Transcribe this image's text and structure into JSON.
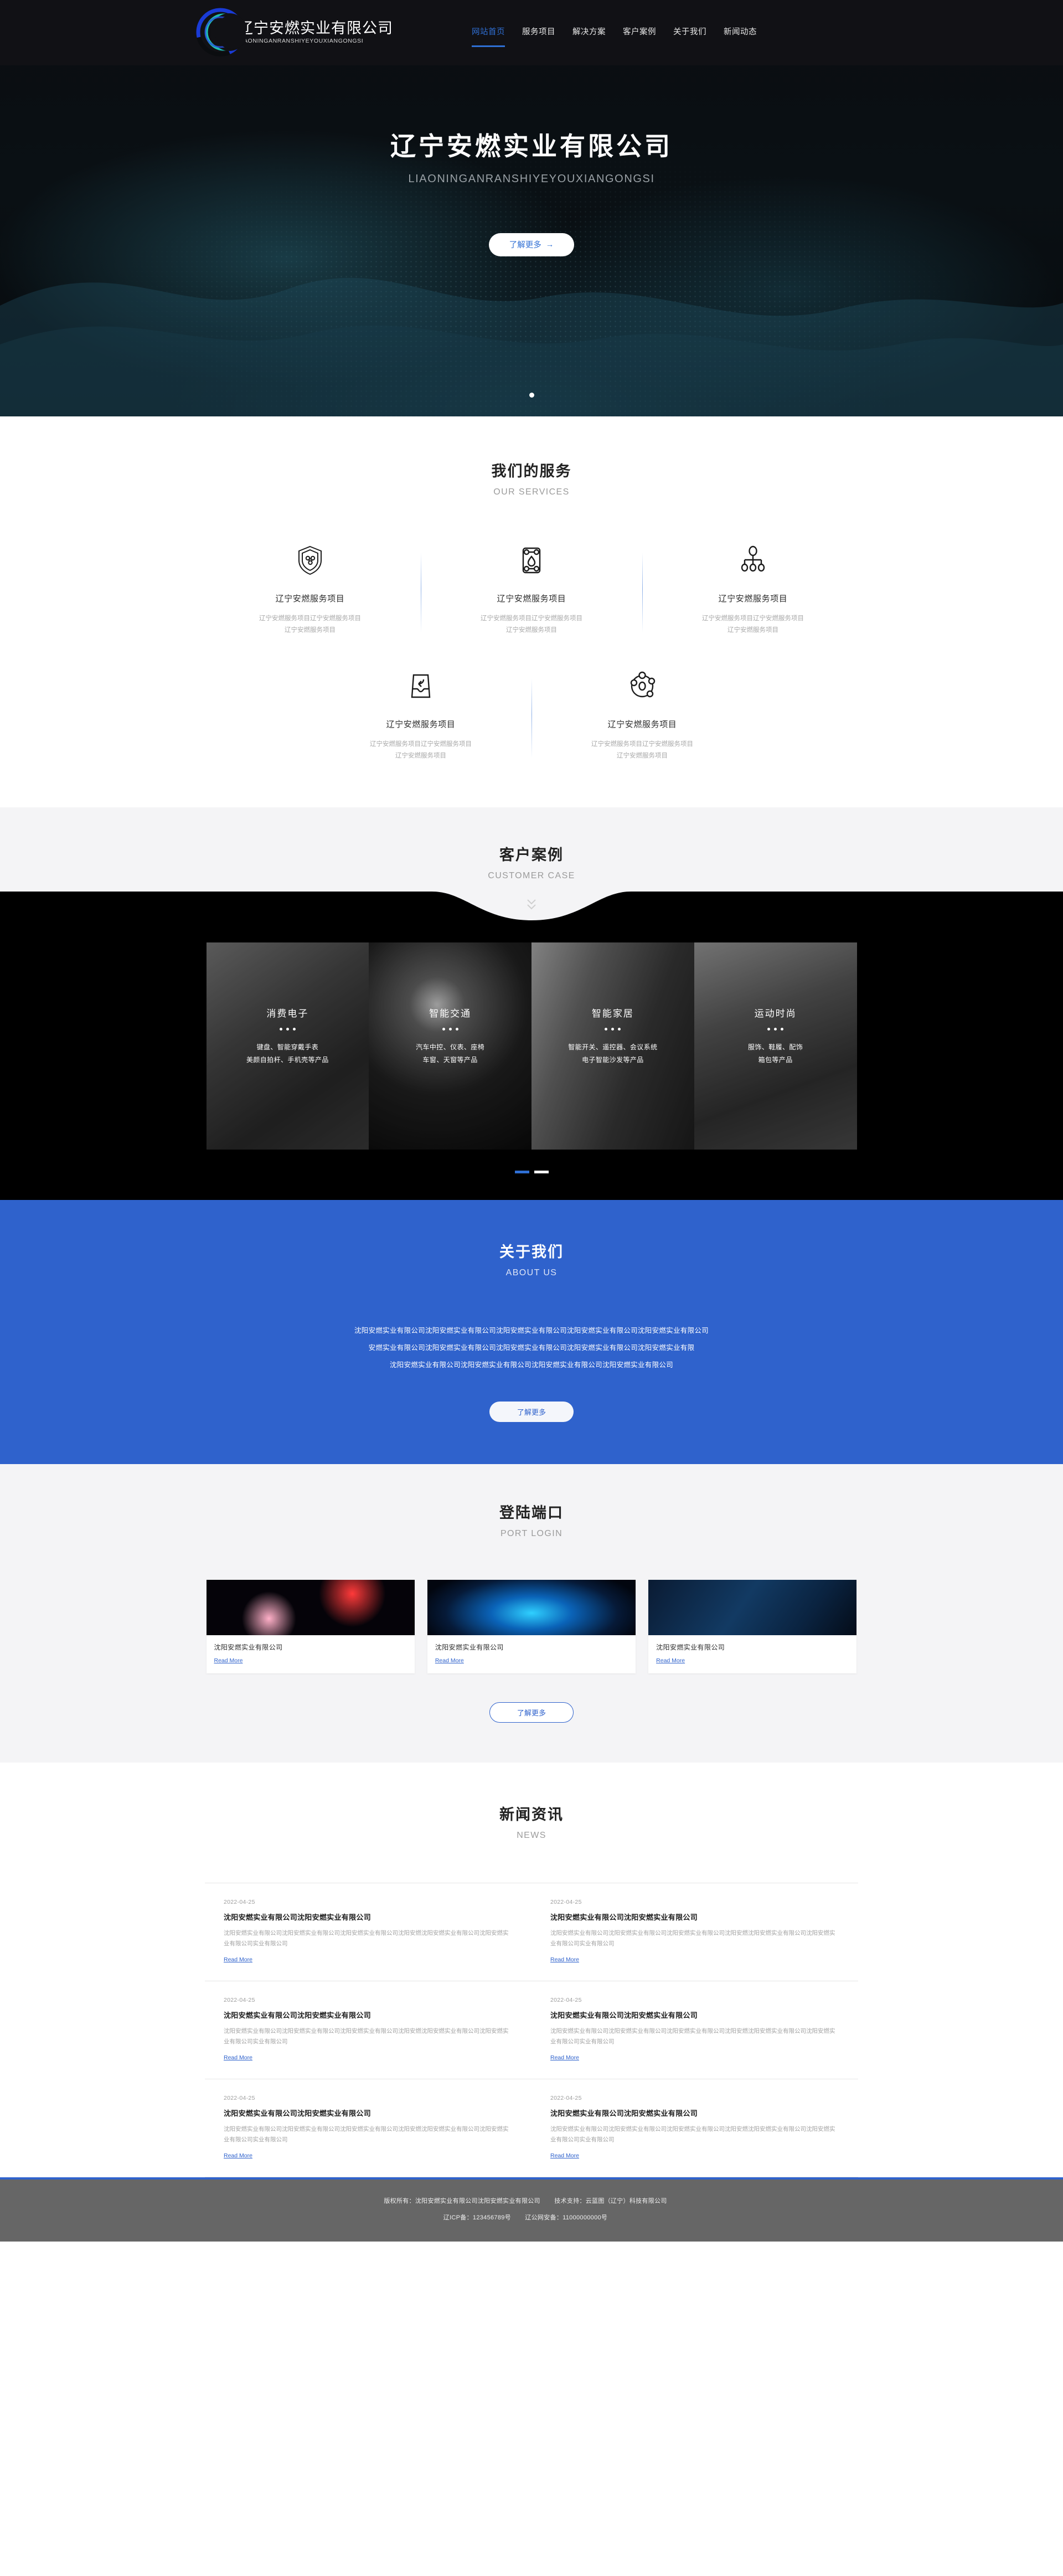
{
  "brand": {
    "name_cn": "辽宁安燃实业有限公司",
    "name_en": "LIAONINGANRANSHIYEYOUXIANGONGSI",
    "accent": "#2f62cc",
    "logo_icon": "crescent-ring-logo"
  },
  "nav": {
    "items": [
      {
        "label": "网站首页",
        "active": true
      },
      {
        "label": "服务项目",
        "active": false
      },
      {
        "label": "解决方案",
        "active": false
      },
      {
        "label": "客户案例",
        "active": false
      },
      {
        "label": "关于我们",
        "active": false
      },
      {
        "label": "新闻动态",
        "active": false
      }
    ]
  },
  "hero": {
    "title": "辽宁安燃实业有限公司",
    "subtitle": "LIAONINGANRANSHIYEYOUXIANGONGSI",
    "cta": "了解更多",
    "cta_arrow": "→",
    "slides": 1,
    "active_slide": 1
  },
  "services": {
    "title_cn": "我们的服务",
    "title_en": "OUR SERVICES",
    "items": [
      {
        "icon": "shield-molecule-icon",
        "name": "辽宁安燃服务项目",
        "desc": "辽宁安燃服务项目辽宁安燃服务项目辽宁安燃服务项目"
      },
      {
        "icon": "battery-drop-icon",
        "name": "辽宁安燃服务项目",
        "desc": "辽宁安燃服务项目辽宁安燃服务项目辽宁安燃服务项目"
      },
      {
        "icon": "hierarchy-node-icon",
        "name": "辽宁安燃服务项目",
        "desc": "辽宁安燃服务项目辽宁安燃服务项目辽宁安燃服务项目"
      },
      {
        "icon": "return-box-icon",
        "name": "辽宁安燃服务项目",
        "desc": "辽宁安燃服务项目辽宁安燃服务项目辽宁安燃服务项目"
      },
      {
        "icon": "molecule-cluster-icon",
        "name": "辽宁安燃服务项目",
        "desc": "辽宁安燃服务项目辽宁安燃服务项目辽宁安燃服务项目"
      }
    ]
  },
  "cases": {
    "title_cn": "客户案例",
    "title_en": "CUSTOMER CASE",
    "chevron_icon": "chevron-double-down-icon",
    "items": [
      {
        "title": "消费电子",
        "line1": "键盘、智能穿戴手表",
        "line2": "美颜自拍杆、手机壳等产品",
        "image": "vr-headset-photo"
      },
      {
        "title": "智能交通",
        "line1": "汽车中控、仪表、座椅",
        "line2": "车窗、天窗等产品",
        "image": "wireframe-car-photo"
      },
      {
        "title": "智能家居",
        "line1": "智能开关、遥控器、会议系统",
        "line2": "电子智能沙发等产品",
        "image": "modern-interior-photo"
      },
      {
        "title": "运动时尚",
        "line1": "服饰、鞋履、配饰",
        "line2": "箱包等产品",
        "image": "runners-photo"
      }
    ],
    "pages": 2,
    "active_page": 1
  },
  "about": {
    "title_cn": "关于我们",
    "title_en": "ABOUT US",
    "paragraphs": [
      "沈阳安燃实业有限公司沈阳安燃实业有限公司沈阳安燃实业有限公司沈阳安燃实业有限公司沈阳安燃实业有限公司",
      "安燃实业有限公司沈阳安燃实业有限公司沈阳安燃实业有限公司沈阳安燃实业有限公司沈阳安燃实业有限",
      "沈阳安燃实业有限公司沈阳安燃实业有限公司沈阳安燃实业有限公司沈阳安燃实业有限公司"
    ],
    "cta": "了解更多"
  },
  "port": {
    "title_cn": "登陆端口",
    "title_en": "PORT LOGIN",
    "cards": [
      {
        "image": "neon-squiggle-photo",
        "title": "沈阳安燃实业有限公司",
        "link": "Read More"
      },
      {
        "image": "blue-binary-photo",
        "title": "沈阳安燃实业有限公司",
        "link": "Read More"
      },
      {
        "image": "padlock-photo",
        "title": "沈阳安燃实业有限公司",
        "link": "Read More"
      }
    ],
    "cta": "了解更多"
  },
  "news": {
    "title_cn": "新闻资讯",
    "title_en": "NEWS",
    "items": [
      {
        "date": "2022-04-25",
        "title": "沈阳安燃实业有限公司沈阳安燃实业有限公司",
        "desc": "沈阳安燃实业有限公司沈阳安燃实业有限公司沈阳安燃实业有限公司沈阳安燃沈阳安燃实业有限公司沈阳安燃实业有限公司实业有限公司",
        "link": "Read More"
      },
      {
        "date": "2022-04-25",
        "title": "沈阳安燃实业有限公司沈阳安燃实业有限公司",
        "desc": "沈阳安燃实业有限公司沈阳安燃实业有限公司沈阳安燃实业有限公司沈阳安燃沈阳安燃实业有限公司沈阳安燃实业有限公司实业有限公司",
        "link": "Read More"
      },
      {
        "date": "2022-04-25",
        "title": "沈阳安燃实业有限公司沈阳安燃实业有限公司",
        "desc": "沈阳安燃实业有限公司沈阳安燃实业有限公司沈阳安燃实业有限公司沈阳安燃沈阳安燃实业有限公司沈阳安燃实业有限公司实业有限公司",
        "link": "Read More"
      },
      {
        "date": "2022-04-25",
        "title": "沈阳安燃实业有限公司沈阳安燃实业有限公司",
        "desc": "沈阳安燃实业有限公司沈阳安燃实业有限公司沈阳安燃实业有限公司沈阳安燃沈阳安燃实业有限公司沈阳安燃实业有限公司实业有限公司",
        "link": "Read More"
      },
      {
        "date": "2022-04-25",
        "title": "沈阳安燃实业有限公司沈阳安燃实业有限公司",
        "desc": "沈阳安燃实业有限公司沈阳安燃实业有限公司沈阳安燃实业有限公司沈阳安燃沈阳安燃实业有限公司沈阳安燃实业有限公司实业有限公司",
        "link": "Read More"
      },
      {
        "date": "2022-04-25",
        "title": "沈阳安燃实业有限公司沈阳安燃实业有限公司",
        "desc": "沈阳安燃实业有限公司沈阳安燃实业有限公司沈阳安燃实业有限公司沈阳安燃沈阳安燃实业有限公司沈阳安燃实业有限公司实业有限公司",
        "link": "Read More"
      }
    ]
  },
  "footer": {
    "copyright": "版权所有：沈阳安燃实业有限公司沈阳安燃实业有限公司",
    "support": "技术支持：云蓝图（辽宁）科技有限公司",
    "icp": "辽ICP备：123456789号",
    "police": "辽公网安备：11000000000号"
  }
}
